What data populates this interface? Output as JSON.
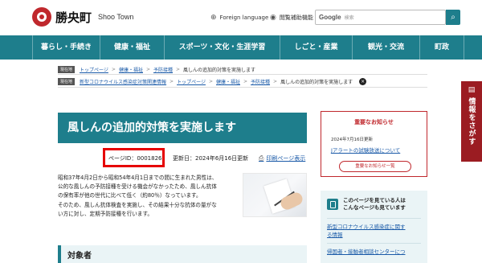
{
  "header": {
    "logo_jp": "勝央町",
    "logo_en": "Shoo Town",
    "foreign_language": "Foreign language",
    "reading_aid": "閲覧補助機能",
    "search_brand": "Google",
    "search_placeholder": "検索"
  },
  "nav": {
    "items": [
      {
        "label": "暮らし・手続き"
      },
      {
        "label": "健康・福祉"
      },
      {
        "label": "スポーツ・文化・生涯学習"
      },
      {
        "label": "しごと・産業"
      },
      {
        "label": "観光・交流"
      },
      {
        "label": "町政"
      }
    ]
  },
  "breadcrumbs": [
    {
      "tag": "現在地",
      "items": [
        "トップページ",
        "健康・福祉",
        "予防接種"
      ],
      "current": "風しんの追加的対策を実施します"
    },
    {
      "tag": "現在地",
      "items": [
        "新型コロナウイルス感染症対策関連情報",
        "トップページ",
        "健康・福祉",
        "予防接種"
      ],
      "current": "風しんの追加的対策を実施します"
    }
  ],
  "sidetab": {
    "label": "情報をさがす"
  },
  "main": {
    "title": "風しんの追加的対策を実施します",
    "page_id": "ページID：0001826",
    "updated": "更新日：2024年6月16日更新",
    "print": "印刷ページ表示",
    "body": [
      "昭和37年4月2日から昭和54年4月1日までの間に生まれた男性は、",
      "公的な風しんの予防接種を受ける機会がなかったため、風しん抗体",
      "の保有率が他の世代に比べて低く（約80％）なっています。",
      "そのため、風しん抗体検査を実施し、その結果十分な抗体の量がな",
      "い方に対し、定期予防接種を行います。"
    ],
    "section_heading": "対象者"
  },
  "notice": {
    "heading": "重要なお知らせ",
    "date": "2024年7月16日更新",
    "item": "Jアラートの試験放送について",
    "button": "重要なお知らせ一覧"
  },
  "also_viewed": {
    "heading_line1": "このページを見ている人は",
    "heading_line2": "こんなページも見ています",
    "links": [
      "新型コロナウイルス感染症に関す",
      "る情報",
      "帰国者・接触者相談センターにつ"
    ]
  }
}
